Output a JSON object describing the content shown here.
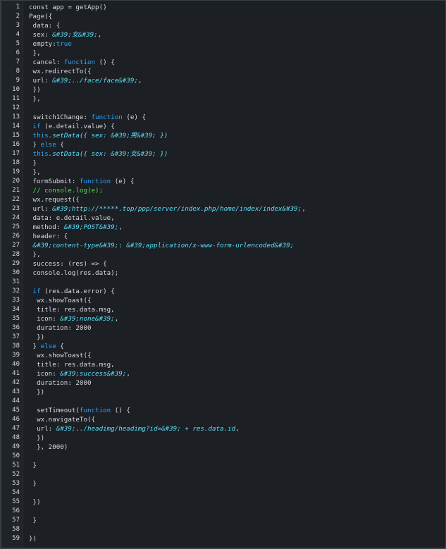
{
  "editor": {
    "lines": [
      [
        {
          "t": "const app = getApp()",
          "c": "p"
        }
      ],
      [
        {
          "t": "Page({",
          "c": "p"
        }
      ],
      [
        {
          "t": " data: {",
          "c": "p"
        }
      ],
      [
        {
          "t": " sex: ",
          "c": "p"
        },
        {
          "t": "&#39;女&#39;",
          "c": "s"
        },
        {
          "t": ",",
          "c": "p"
        }
      ],
      [
        {
          "t": " empty:",
          "c": "p"
        },
        {
          "t": "true",
          "c": "k"
        }
      ],
      [
        {
          "t": " },",
          "c": "p"
        }
      ],
      [
        {
          "t": " cancel: ",
          "c": "p"
        },
        {
          "t": "function",
          "c": "k"
        },
        {
          "t": " () {",
          "c": "p"
        }
      ],
      [
        {
          "t": " wx.redirectTo({",
          "c": "p"
        }
      ],
      [
        {
          "t": " url: ",
          "c": "p"
        },
        {
          "t": "&#39;../face/face&#39;",
          "c": "s"
        },
        {
          "t": ",",
          "c": "p"
        }
      ],
      [
        {
          "t": " })",
          "c": "p"
        }
      ],
      [
        {
          "t": " },",
          "c": "p"
        }
      ],
      [
        {
          "t": "",
          "c": "p"
        }
      ],
      [
        {
          "t": " switch1Change: ",
          "c": "p"
        },
        {
          "t": "function",
          "c": "k"
        },
        {
          "t": " (e) {",
          "c": "p"
        }
      ],
      [
        {
          "t": " ",
          "c": "p"
        },
        {
          "t": "if",
          "c": "k"
        },
        {
          "t": " (e.detail.value) {",
          "c": "p"
        }
      ],
      [
        {
          "t": " ",
          "c": "p"
        },
        {
          "t": "this",
          "c": "k"
        },
        {
          "t": ".setData({ sex: &#39;",
          "c": "s"
        },
        {
          "t": "男",
          "c": "s"
        },
        {
          "t": "&#39; })",
          "c": "s"
        }
      ],
      [
        {
          "t": " } ",
          "c": "p"
        },
        {
          "t": "else",
          "c": "k"
        },
        {
          "t": " {",
          "c": "p"
        }
      ],
      [
        {
          "t": " ",
          "c": "p"
        },
        {
          "t": "this",
          "c": "k"
        },
        {
          "t": ".setData({ sex: &#39;",
          "c": "s"
        },
        {
          "t": "女",
          "c": "s"
        },
        {
          "t": "&#39; })",
          "c": "s"
        }
      ],
      [
        {
          "t": " }",
          "c": "p"
        }
      ],
      [
        {
          "t": " },",
          "c": "p"
        }
      ],
      [
        {
          "t": " formSubmit: ",
          "c": "p"
        },
        {
          "t": "function",
          "c": "k"
        },
        {
          "t": " (e) {",
          "c": "p"
        }
      ],
      [
        {
          "t": " ",
          "c": "p"
        },
        {
          "t": "// console.log(e);",
          "c": "c"
        }
      ],
      [
        {
          "t": " wx.request({",
          "c": "p"
        }
      ],
      [
        {
          "t": " url: ",
          "c": "p"
        },
        {
          "t": "&#39;http://*****.top/ppp/server/index.php/home/index/index&#39;",
          "c": "s"
        },
        {
          "t": ",",
          "c": "p"
        }
      ],
      [
        {
          "t": " data: e.detail.value,",
          "c": "p"
        }
      ],
      [
        {
          "t": " method: ",
          "c": "p"
        },
        {
          "t": "&#39;POST&#39;",
          "c": "s"
        },
        {
          "t": ",",
          "c": "p"
        }
      ],
      [
        {
          "t": " header: {",
          "c": "p"
        }
      ],
      [
        {
          "t": " ",
          "c": "p"
        },
        {
          "t": "&#39;content-type&#39;",
          "c": "s"
        },
        {
          "t": ": ",
          "c": "p"
        },
        {
          "t": "&#39;application/x-www-form-urlencoded&#39;",
          "c": "s"
        }
      ],
      [
        {
          "t": " },",
          "c": "p"
        }
      ],
      [
        {
          "t": " success: (res) => {",
          "c": "p"
        }
      ],
      [
        {
          "t": " console.log(res.data);",
          "c": "p"
        }
      ],
      [
        {
          "t": "",
          "c": "p"
        }
      ],
      [
        {
          "t": " ",
          "c": "p"
        },
        {
          "t": "if",
          "c": "k"
        },
        {
          "t": " (res.data.error) {",
          "c": "p"
        }
      ],
      [
        {
          "t": "  wx.showToast({",
          "c": "p"
        }
      ],
      [
        {
          "t": "  title: res.data.msg,",
          "c": "p"
        }
      ],
      [
        {
          "t": "  icon: ",
          "c": "p"
        },
        {
          "t": "&#39;none&#39;",
          "c": "s"
        },
        {
          "t": ",",
          "c": "p"
        }
      ],
      [
        {
          "t": "  duration: 2000",
          "c": "p"
        }
      ],
      [
        {
          "t": "  })",
          "c": "p"
        }
      ],
      [
        {
          "t": " } ",
          "c": "p"
        },
        {
          "t": "else",
          "c": "k"
        },
        {
          "t": " {",
          "c": "p"
        }
      ],
      [
        {
          "t": "  wx.showToast({",
          "c": "p"
        }
      ],
      [
        {
          "t": "  title: res.data.msg,",
          "c": "p"
        }
      ],
      [
        {
          "t": "  icon: ",
          "c": "p"
        },
        {
          "t": "&#39;success&#39;",
          "c": "s"
        },
        {
          "t": ",",
          "c": "p"
        }
      ],
      [
        {
          "t": "  duration: 2000",
          "c": "p"
        }
      ],
      [
        {
          "t": "  })",
          "c": "p"
        }
      ],
      [
        {
          "t": "",
          "c": "p"
        }
      ],
      [
        {
          "t": "  setTimeout(",
          "c": "p"
        },
        {
          "t": "function",
          "c": "k"
        },
        {
          "t": " () {",
          "c": "p"
        }
      ],
      [
        {
          "t": "  wx.navigateTo({",
          "c": "p"
        }
      ],
      [
        {
          "t": "  url: ",
          "c": "p"
        },
        {
          "t": "&#39;../headimg/headimg?id=&#39; + res.data.id",
          "c": "s"
        },
        {
          "t": ",",
          "c": "p"
        }
      ],
      [
        {
          "t": "  })",
          "c": "p"
        }
      ],
      [
        {
          "t": "  }, 2000)",
          "c": "p"
        }
      ],
      [
        {
          "t": "",
          "c": "p"
        }
      ],
      [
        {
          "t": " }",
          "c": "p"
        }
      ],
      [
        {
          "t": "",
          "c": "p"
        }
      ],
      [
        {
          "t": " }",
          "c": "p"
        }
      ],
      [
        {
          "t": "",
          "c": "p"
        }
      ],
      [
        {
          "t": " })",
          "c": "p"
        }
      ],
      [
        {
          "t": "",
          "c": "p"
        }
      ],
      [
        {
          "t": " }",
          "c": "p"
        }
      ],
      [
        {
          "t": "",
          "c": "p"
        }
      ],
      [
        {
          "t": "})",
          "c": "p"
        }
      ]
    ]
  }
}
